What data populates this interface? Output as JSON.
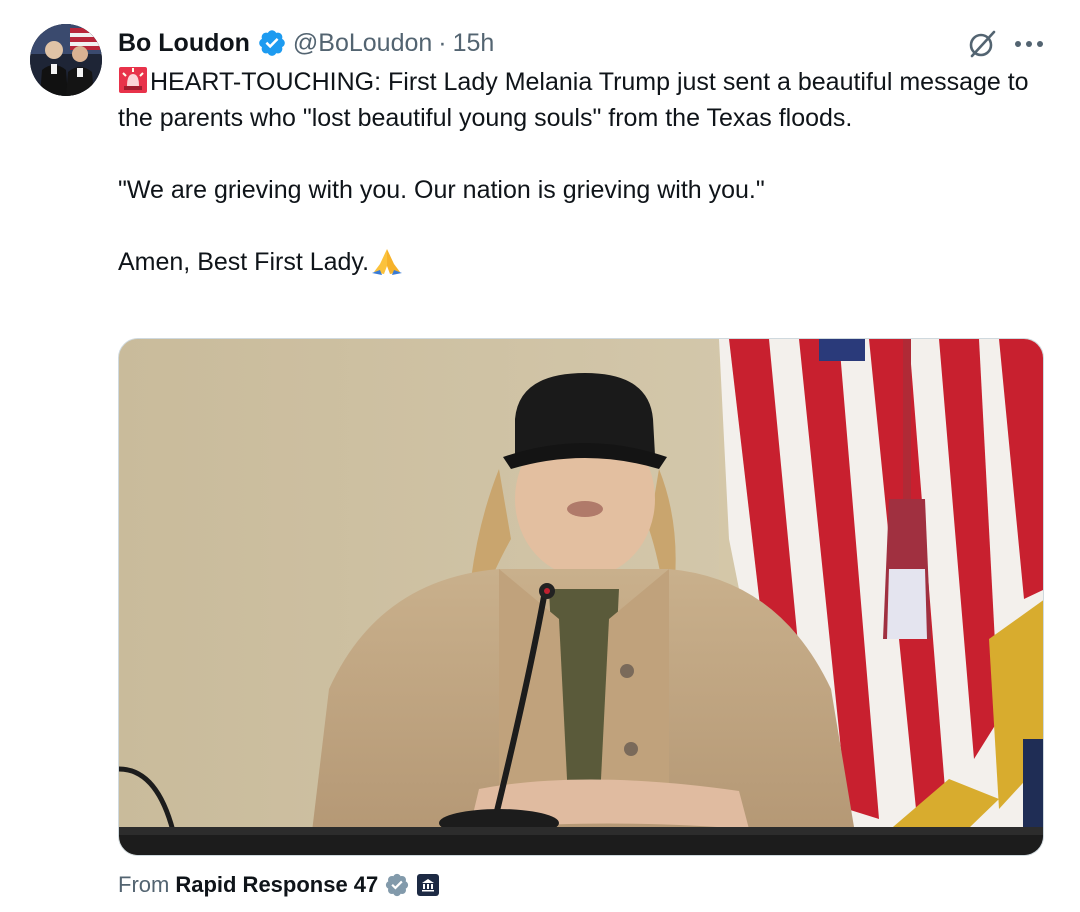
{
  "author": {
    "display_name": "Bo Loudon",
    "handle": "@BoLoudon",
    "separator": "·",
    "timestamp": "15h"
  },
  "tweet": {
    "line1": "HEART-TOUCHING: First Lady Melania Trump just sent a beautiful message to the parents who \"lost beautiful young souls\" from the Texas floods.",
    "line2": "\"We are grieving with you. Our nation is grieving with you.\"",
    "line3": "Amen, Best First Lady."
  },
  "media_source": {
    "label": "From",
    "name": "Rapid Response 47"
  },
  "icons": {
    "verified": "verified-badge-icon",
    "grok": "grok-icon",
    "more": "more-options-icon",
    "siren": "rotating-light-emoji",
    "pray": "folded-hands-emoji",
    "source_verified": "gray-verified-badge-icon",
    "source_org": "government-badge-icon"
  },
  "colors": {
    "verified_blue": "#1d9bf0",
    "secondary_text": "#536471",
    "primary_text": "#0f1419"
  }
}
